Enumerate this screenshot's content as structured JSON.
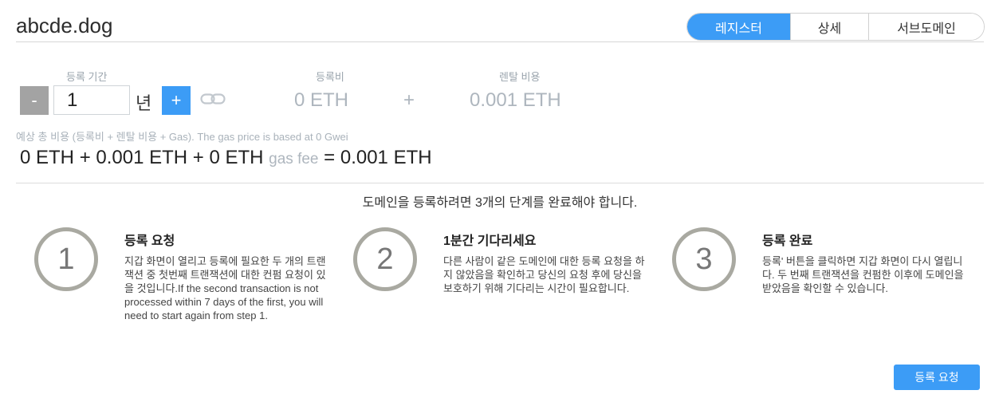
{
  "header": {
    "domain_name": "abcde.dog",
    "tabs": [
      {
        "label": "레지스터",
        "active": true
      },
      {
        "label": "상세",
        "active": false
      },
      {
        "label": "서브도메인",
        "active": false
      }
    ]
  },
  "registration": {
    "period_label": "등록 기간",
    "minus_label": "-",
    "years_value": "1",
    "year_unit": "년",
    "plus_label": "+",
    "fee_label": "등록비",
    "fee_value": "0 ETH",
    "plus_sign": "+",
    "rent_label": "렌탈 비용",
    "rent_value": "0.001 ETH"
  },
  "estimate": {
    "label": "예상 총 비용 (등록비 + 렌탈 비용 + Gas). The gas price is based at 0 Gwei",
    "fee": "0 ETH",
    "op1": "+",
    "rent": "0.001 ETH",
    "op2": "+",
    "gas": "0 ETH",
    "gas_label": "gas fee",
    "eq": "=",
    "total": "0.001 ETH"
  },
  "steps_intro": "도메인을 등록하려면 3개의 단계를 완료해야 합니다.",
  "steps": [
    {
      "number": "1",
      "title": "등록 요청",
      "description": "지갑 화면이 열리고 등록에 필요한 두 개의 트랜잭션 중 첫번째 트랜잭션에 대한 컨펌 요청이 있을 것입니다.If the second transaction is not processed within 7 days of the first, you will need to start again from step 1."
    },
    {
      "number": "2",
      "title": "1분간 기다리세요",
      "description": "다른 사람이 같은 도메인에 대한 등록 요청을 하지 않았음을 확인하고 당신의 요청 후에 당신을 보호하기 위해 기다리는 시간이 필요합니다."
    },
    {
      "number": "3",
      "title": "등록 완료",
      "description": "등록' 버튼을 클릭하면 지갑 화면이 다시 열립니다. 두 번째 트랜잭션을 컨펌한 이후에 도메인을 받았음을 확인할 수 있습니다."
    }
  ],
  "action_button": "등록 요청",
  "colors": {
    "accent": "#3c9cf6",
    "muted": "#aeb6be",
    "circle": "#a9a9a1"
  },
  "icons": {
    "link": "link-icon"
  }
}
